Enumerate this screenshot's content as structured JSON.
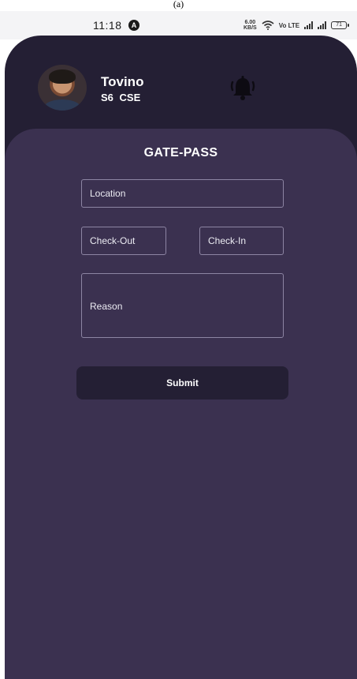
{
  "caption": "(a)",
  "status_bar": {
    "time": "11:18",
    "notification_badge": "A",
    "net_speed_value": "6.00",
    "net_speed_unit": "KB/S",
    "volte": "Vo LTE",
    "battery": "71"
  },
  "profile": {
    "name": "Tovino",
    "class_info": "S6 CSE",
    "notification_icon": "bell-ringing-icon"
  },
  "form": {
    "title": "GATE-PASS",
    "location_placeholder": "Location",
    "checkout_placeholder": "Check-Out",
    "checkin_placeholder": "Check-In",
    "reason_placeholder": "Reason",
    "submit_label": "Submit"
  },
  "colors": {
    "header_bg": "#241f34",
    "panel_bg": "#3b3150",
    "field_border": "#8d85a3",
    "button_bg": "#241f34",
    "text": "#ffffff"
  }
}
